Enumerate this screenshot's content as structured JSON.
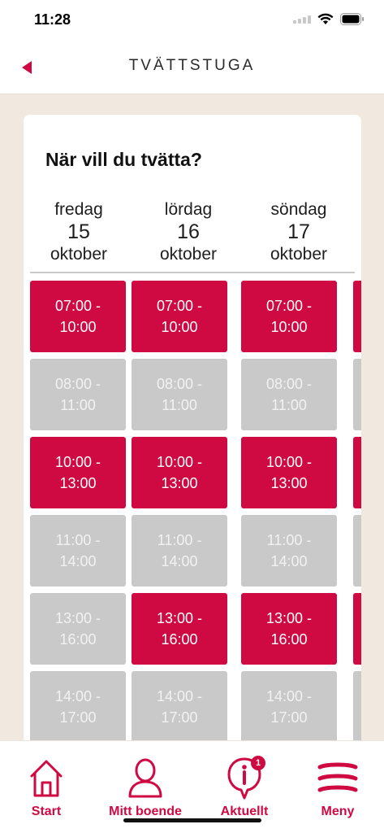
{
  "status": {
    "time": "11:28"
  },
  "nav": {
    "title": "TVÄTTSTUGA",
    "back_icon": "back-triangle-icon"
  },
  "heading": "När vill du tvätta?",
  "colors": {
    "accent": "#cf0a43",
    "booked": "#c9c9c9",
    "background": "#f1e9df"
  },
  "days": [
    {
      "name": "fredag",
      "number": "15",
      "month": "oktober"
    },
    {
      "name": "lördag",
      "number": "16",
      "month": "oktober"
    },
    {
      "name": "söndag",
      "number": "17",
      "month": "oktober"
    }
  ],
  "slots": [
    [
      {
        "start": "07:00 -",
        "end": "10:00",
        "status": "available"
      },
      {
        "start": "08:00 -",
        "end": "11:00",
        "status": "booked"
      },
      {
        "start": "10:00 -",
        "end": "13:00",
        "status": "available"
      },
      {
        "start": "11:00 -",
        "end": "14:00",
        "status": "booked"
      },
      {
        "start": "13:00 -",
        "end": "16:00",
        "status": "booked"
      },
      {
        "start": "14:00 -",
        "end": "17:00",
        "status": "booked"
      }
    ],
    [
      {
        "start": "07:00 -",
        "end": "10:00",
        "status": "available"
      },
      {
        "start": "08:00 -",
        "end": "11:00",
        "status": "booked"
      },
      {
        "start": "10:00 -",
        "end": "13:00",
        "status": "available"
      },
      {
        "start": "11:00 -",
        "end": "14:00",
        "status": "booked"
      },
      {
        "start": "13:00 -",
        "end": "16:00",
        "status": "available"
      },
      {
        "start": "14:00 -",
        "end": "17:00",
        "status": "booked"
      }
    ],
    [
      {
        "start": "07:00 -",
        "end": "10:00",
        "status": "available"
      },
      {
        "start": "08:00 -",
        "end": "11:00",
        "status": "booked"
      },
      {
        "start": "10:00 -",
        "end": "13:00",
        "status": "available"
      },
      {
        "start": "11:00 -",
        "end": "14:00",
        "status": "booked"
      },
      {
        "start": "13:00 -",
        "end": "16:00",
        "status": "available"
      },
      {
        "start": "14:00 -",
        "end": "17:00",
        "status": "booked"
      }
    ]
  ],
  "fourth_column_status": [
    "available",
    "booked",
    "available",
    "booked",
    "available",
    "booked"
  ],
  "tabs": [
    {
      "label": "Start",
      "icon": "house-icon"
    },
    {
      "label": "Mitt boende",
      "icon": "person-icon"
    },
    {
      "label": "Aktuellt",
      "icon": "info-icon",
      "badge": "1"
    },
    {
      "label": "Meny",
      "icon": "menu-icon"
    }
  ]
}
